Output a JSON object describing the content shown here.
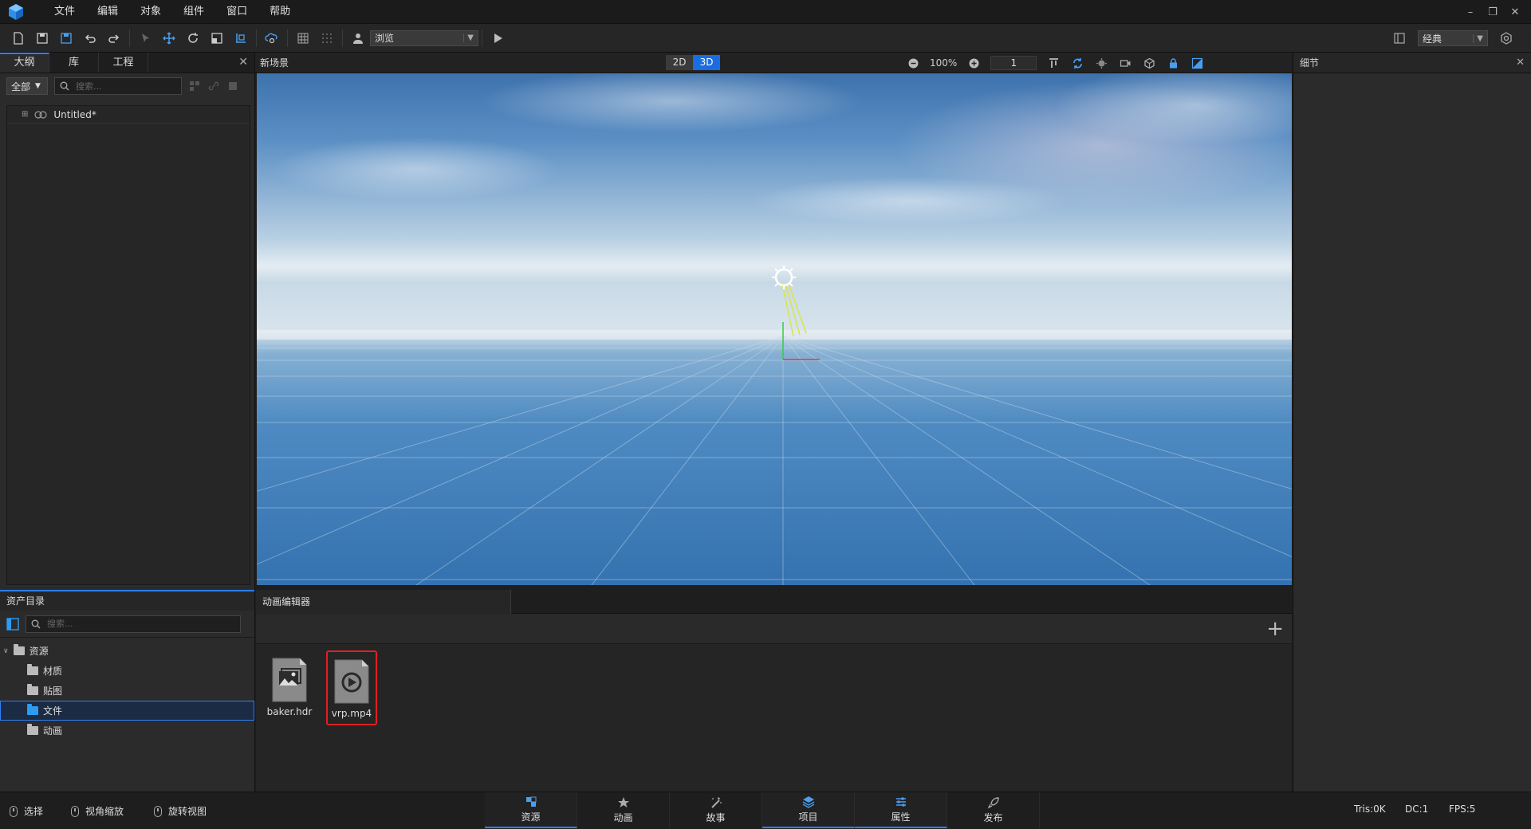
{
  "menu": {
    "items": [
      "文件",
      "编辑",
      "对象",
      "组件",
      "窗口",
      "帮助"
    ]
  },
  "window_controls": {
    "minimize": "–",
    "restore": "❐",
    "close": "✕"
  },
  "toolbar": {
    "mode_select": "浏览",
    "layout_select": "经典"
  },
  "left_panel": {
    "tabs": [
      "大纲",
      "库",
      "工程"
    ],
    "close": "✕",
    "filter": "全部",
    "search_placeholder": "搜索...",
    "tree_root": "Untitled*"
  },
  "viewport": {
    "title": "新场景",
    "dim_2d": "2D",
    "dim_3d": "3D",
    "active_dim": "3D",
    "zoom": "100%",
    "frame": "1"
  },
  "right_panel": {
    "title": "细节",
    "close": "✕"
  },
  "assets": {
    "title": "资产目录",
    "search_placeholder": "搜索...",
    "root": "资源",
    "folders": [
      "材质",
      "贴图",
      "文件",
      "动画"
    ],
    "selected_folder": "文件"
  },
  "anim_editor": {
    "title": "动画编辑器",
    "add": "+",
    "files": [
      {
        "name": "baker.hdr",
        "type": "image"
      },
      {
        "name": "vrp.mp4",
        "type": "video",
        "highlighted": true
      }
    ]
  },
  "statusbar": {
    "hints": [
      "选择",
      "视角缩放",
      "旋转视图"
    ],
    "nav_tabs": [
      "资源",
      "动画",
      "故事",
      "项目",
      "属性",
      "发布"
    ],
    "active_nav": [
      "资源",
      "项目",
      "属性"
    ],
    "tris": "Tris:0K",
    "dc": "DC:1",
    "fps": "FPS:5"
  },
  "colors": {
    "accent": "#2d7ff9",
    "highlight": "#e02020",
    "panel": "#2b2b2b",
    "sky_top": "#3e72ad",
    "horizon": "#d9e4ec",
    "ground": "#3a78b3"
  }
}
